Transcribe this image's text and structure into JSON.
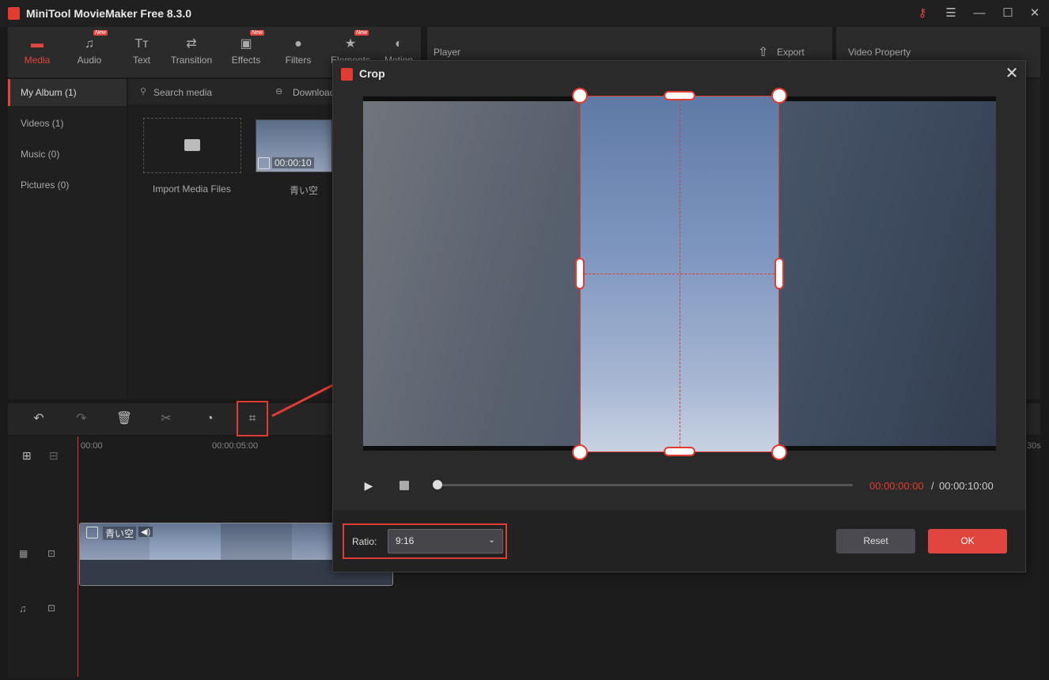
{
  "app": {
    "title": "MiniTool MovieMaker Free 8.3.0"
  },
  "toolbar": {
    "items": [
      {
        "label": "Media",
        "new": false
      },
      {
        "label": "Audio",
        "new": true
      },
      {
        "label": "Text",
        "new": false
      },
      {
        "label": "Transition",
        "new": false
      },
      {
        "label": "Effects",
        "new": true
      },
      {
        "label": "Filters",
        "new": false
      },
      {
        "label": "Elements",
        "new": true
      },
      {
        "label": "Motion",
        "new": false
      }
    ],
    "new_tag": "New"
  },
  "player": {
    "label": "Player",
    "export_label": "Export"
  },
  "property": {
    "label": "Video Property"
  },
  "sidebar": {
    "items": [
      {
        "label": "My Album (1)"
      },
      {
        "label": "Videos (1)"
      },
      {
        "label": "Music (0)"
      },
      {
        "label": "Pictures (0)"
      }
    ]
  },
  "media": {
    "search_placeholder": "Search media",
    "download_label": "Download",
    "import_label": "Import Media Files",
    "clip_name": "青い空",
    "clip_duration": "00:00:10"
  },
  "timeline": {
    "ruler_start": "00:00",
    "ruler_mid": "00:00:05:00",
    "ruler_end": "30s",
    "clip_name": "青い空"
  },
  "crop_dialog": {
    "title": "Crop",
    "time_current": "00:00:00:00",
    "time_separator": "/",
    "time_total": "00:00:10:00",
    "progress": 0,
    "ratio_label": "Ratio:",
    "ratio_value": "9:16",
    "reset_label": "Reset",
    "ok_label": "OK"
  },
  "colors": {
    "accent": "#e0463e",
    "background": "#1a1a1a"
  }
}
